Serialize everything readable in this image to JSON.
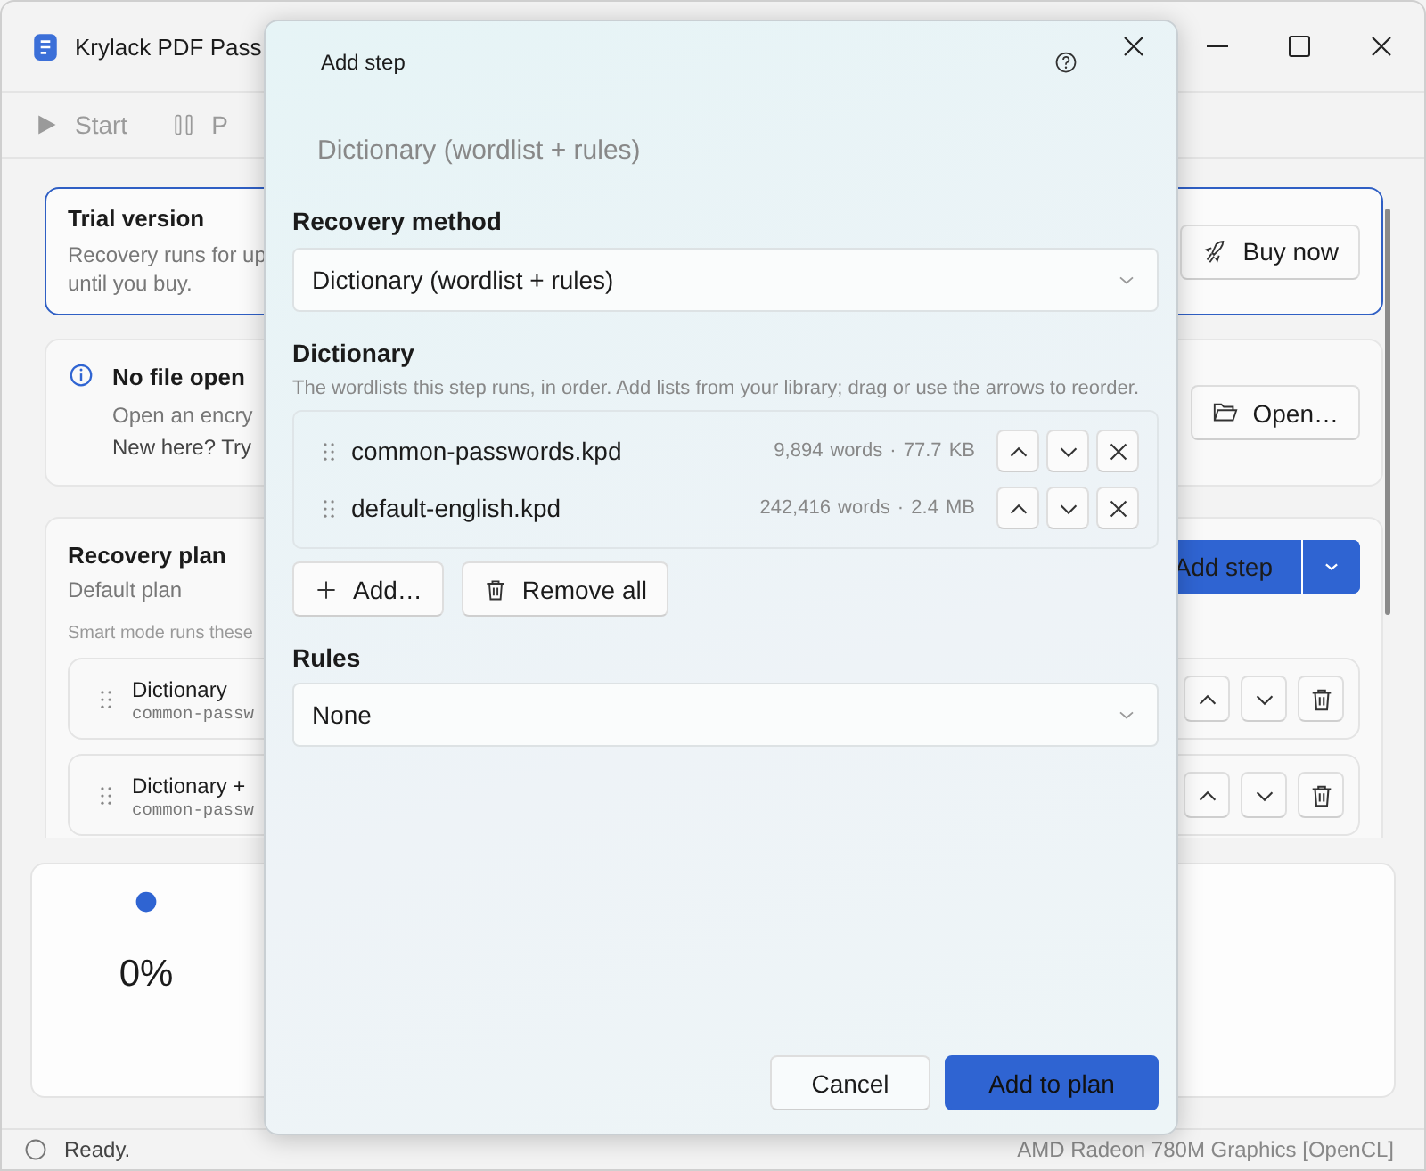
{
  "window": {
    "title": "Krylack PDF Pass"
  },
  "toolbar": [
    {
      "label": "Start",
      "kind": "play",
      "disabled": true
    },
    {
      "label": "P",
      "kind": "pause",
      "disabled": true
    }
  ],
  "trial_card": {
    "title": "Trial version",
    "lines": [
      "Recovery runs for up",
      "until you buy."
    ],
    "button": "Buy now"
  },
  "file_card": {
    "title": "No file open",
    "lines": [
      "Open an encry",
      "New here? Try"
    ],
    "button": "Open…"
  },
  "plan": {
    "title": "Recovery plan",
    "subtitle": "Default plan",
    "note": "Smart mode runs these",
    "add_button": "Add step",
    "steps": [
      {
        "name": "Dictionary",
        "detail": "common-passw"
      },
      {
        "name": "Dictionary +",
        "detail": "common-passw"
      }
    ]
  },
  "progress": {
    "percent": "0%"
  },
  "status_bar": {
    "text": "Ready.",
    "device": "AMD Radeon 780M Graphics [OpenCL]"
  },
  "dialog": {
    "title": "Add step",
    "heading": "Dictionary (wordlist + rules)",
    "method_label": "Recovery method",
    "method": "Dictionary (wordlist + rules)",
    "dictionary_label": "Dictionary",
    "dictionary_hint": "The wordlists this step runs, in order. Add lists from your library; drag or use the arrows to reorder.",
    "wordlists": [
      {
        "name": "common-passwords.kpd",
        "info": "9,894 words · 77.7 KB"
      },
      {
        "name": "default-english.kpd",
        "info": "242,416 words · 2.4 MB"
      }
    ],
    "add_button": "Add…",
    "remove_all_button": "Remove all",
    "rules_label": "Rules",
    "rules": "None",
    "buttons": [
      {
        "label": "Cancel",
        "kind": "secondary"
      },
      {
        "label": "Add to plan",
        "kind": "primary"
      }
    ]
  }
}
